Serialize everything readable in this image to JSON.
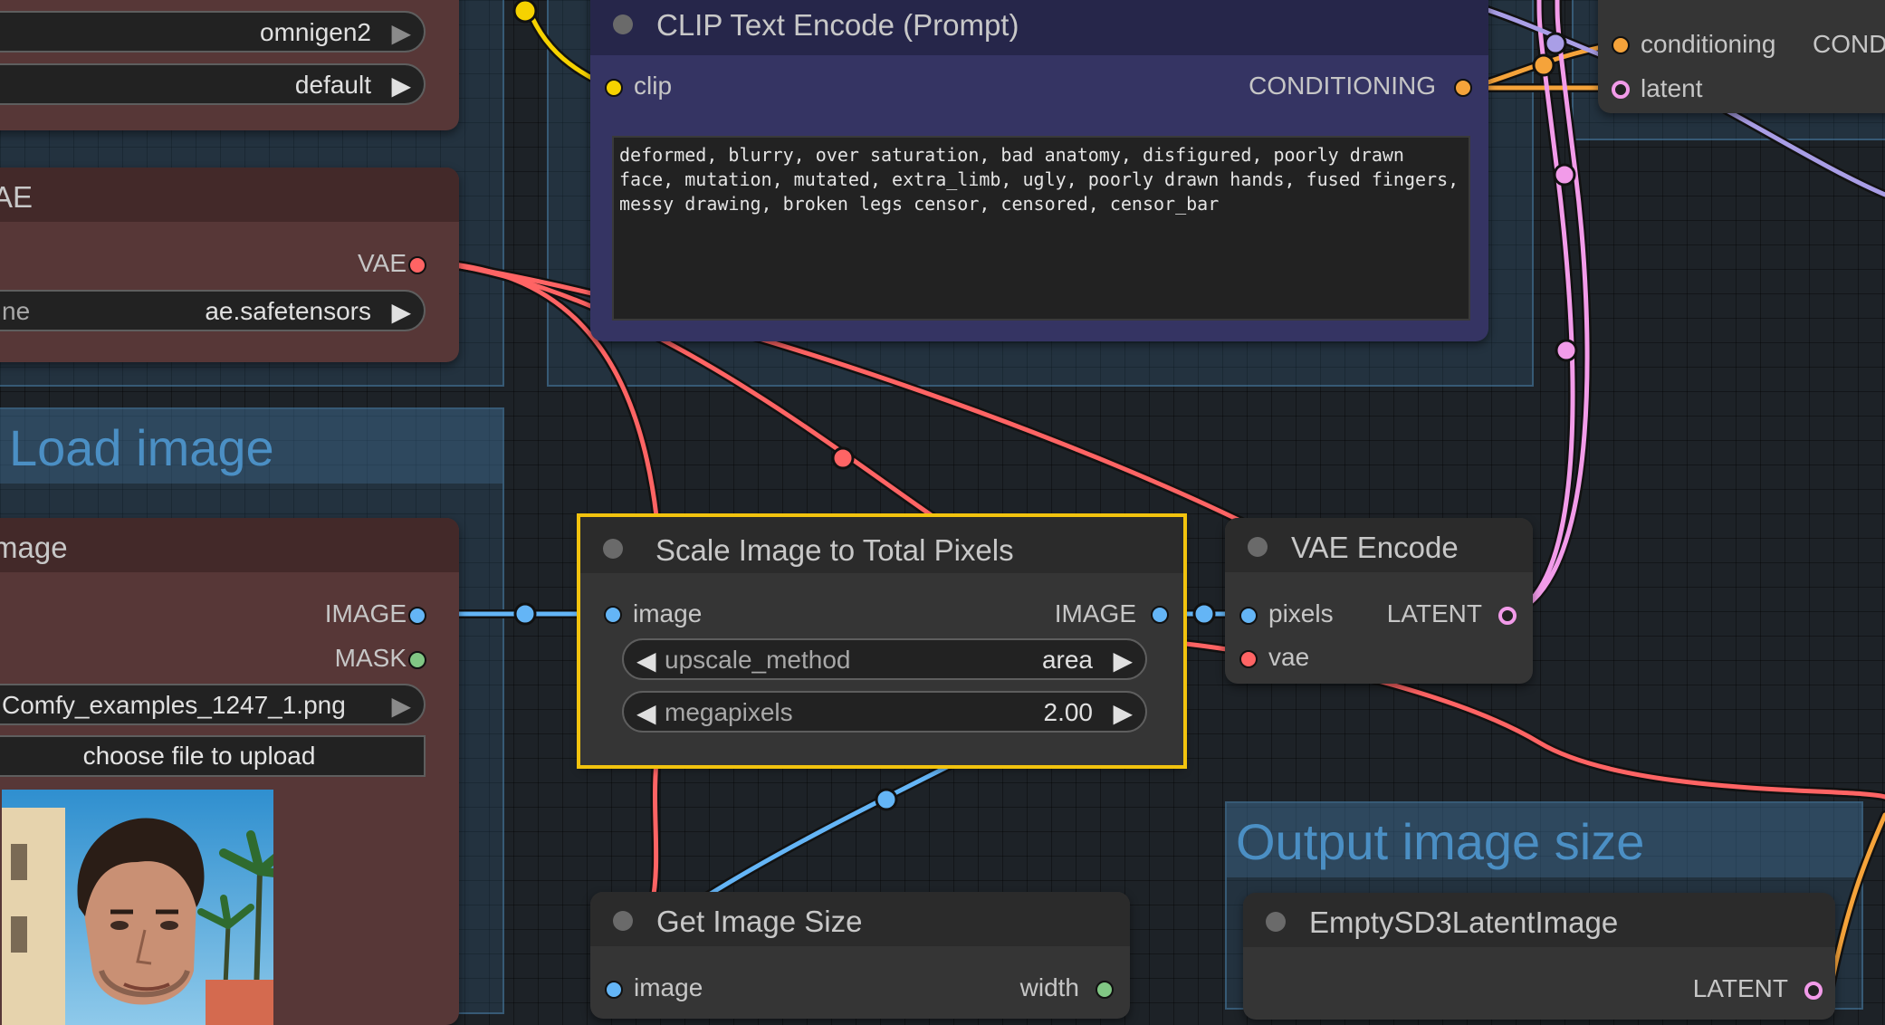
{
  "colors": {
    "clip": "#f6d200",
    "conditioning": "#f5a33a",
    "latent": "#f29be9",
    "vae": "#ff6464",
    "image": "#64b5f6",
    "mask": "#81c784",
    "selected_outline": "#f2c30e"
  },
  "groups": {
    "load_image": {
      "title": "Load image"
    },
    "output_image_size": {
      "title": "Output image size"
    }
  },
  "nodes": {
    "loader_top": {
      "widget1_value": "omnigen2",
      "widget2_value": "default"
    },
    "vae_loader": {
      "title": "AE",
      "output_vae": "VAE",
      "widget_label": "ne",
      "widget_value": "ae.safetensors"
    },
    "load_image": {
      "title": "mage",
      "output_image": "IMAGE",
      "output_mask": "MASK",
      "file_value": "Comfy_examples_1247_1.png",
      "upload_label": "choose file to upload"
    },
    "clip_text_encode": {
      "title": "CLIP Text Encode (Prompt)",
      "input_clip": "clip",
      "output_conditioning": "CONDITIONING",
      "text": "deformed, blurry, over saturation, bad anatomy, disfigured, poorly drawn face, mutation, mutated, extra_limb, ugly, poorly drawn hands, fused fingers, messy drawing, broken legs censor, censored, censor_bar"
    },
    "sampler_partial": {
      "input_conditioning": "conditioning",
      "output_conditioning": "CONDIT",
      "input_latent": "latent"
    },
    "scale_image": {
      "title": "Scale Image to Total Pixels",
      "input_image": "image",
      "output_image": "IMAGE",
      "upscale_label": "upscale_method",
      "upscale_value": "area",
      "megapixels_label": "megapixels",
      "megapixels_value": "2.00"
    },
    "vae_encode": {
      "title": "VAE Encode",
      "input_pixels": "pixels",
      "input_vae": "vae",
      "output_latent": "LATENT"
    },
    "get_image_size": {
      "title": "Get Image Size",
      "input_image": "image",
      "output_width": "width"
    },
    "empty_latent": {
      "title": "EmptySD3LatentImage",
      "output_latent": "LATENT"
    }
  }
}
